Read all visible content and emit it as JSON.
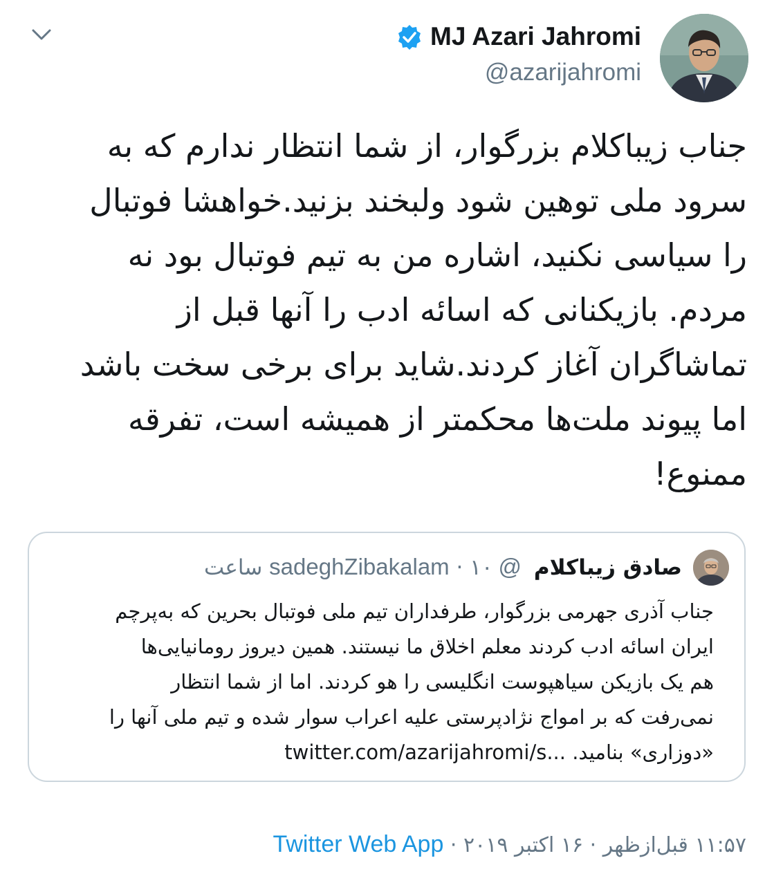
{
  "header": {
    "display_name": "MJ Azari Jahromi",
    "handle": "@azarijahromi",
    "verified_icon": "verified-badge-icon",
    "menu_icon": "chevron-down-icon"
  },
  "tweet": {
    "lines": [
      "جناب زیباکلام بزرگوار، از شما انتظار ندارم که به",
      "سرود ملی توهین شود ولبخند بزنید.خواهشا فوتبال",
      "را سیاسی نکنید، اشاره من به تیم فوتبال بود نه",
      "مردم. بازیکنانی که اسائه ادب را آنها قبل از",
      "تماشاگران آغاز کردند.شاید برای برخی سخت باشد",
      "اما پیوند ملت‌ها محکمتر از همیشه است، تفرقه",
      "ممنوع!"
    ]
  },
  "quoted": {
    "name": "صادق زیباکلام",
    "handle": "@sadeghZibakalam",
    "time": "· ۱۰ ساعت",
    "lines": [
      "جناب آذری جهرمی بزرگوار،  طرفداران تیم ملی فوتبال بحرین که به‌پرچم",
      "ایران اسائه ادب کردند معلم اخلاق ما نیستند. همین دیروز رومانیایی‌ها",
      "هم یک بازیکن سیاهپوست انگلیسی را هو کردند. اما از شما انتظار",
      "نمی‌رفت که بر امواج نژادپرستی علیه اعراب سوار شده و تیم ملی آنها را",
      "«دوزاری» بنامید. ...twitter.com/azarijahromi/s"
    ]
  },
  "footer": {
    "time": "۱۱:۵۷ قبل‌ازظهر",
    "date": "۱۶ اکتبر ۲۰۱۹",
    "separator": "·",
    "source": "Twitter Web App"
  },
  "colors": {
    "text": "#14171a",
    "secondary": "#657786",
    "link": "#1b95e0",
    "verified": "#1da1f2",
    "border": "#ccd6dd"
  }
}
